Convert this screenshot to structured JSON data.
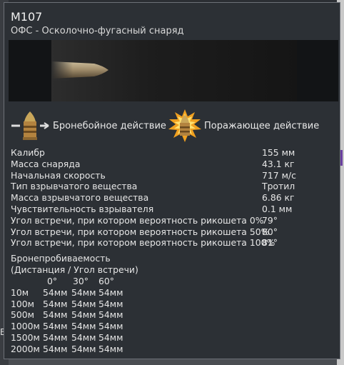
{
  "tooltip": {
    "title": "M107",
    "subtitle": "ОФС - Осколочно-фугасный снаряд"
  },
  "features": {
    "armor_label": "Бронебойное действие",
    "damage_label": "Поражающее действие"
  },
  "stats": [
    {
      "name": "Калибр",
      "value": "155 мм"
    },
    {
      "name": "Масса снаряда",
      "value": "43.1 кг"
    },
    {
      "name": "Начальная скорость",
      "value": "717 м/с"
    },
    {
      "name": "Тип взрывчатого вещества",
      "value": "Тротил"
    },
    {
      "name": "Масса взрывчатого вещества",
      "value": "6.86 кг"
    },
    {
      "name": "Чувствительность взрывателя",
      "value": "0.1 мм"
    },
    {
      "name": "Угол встречи, при котором вероятность рикошета 0%",
      "value": "79°"
    },
    {
      "name": "Угол встречи, при котором вероятность рикошета 50%",
      "value": "80°"
    },
    {
      "name": "Угол встречи, при котором вероятность рикошета 100%",
      "value": "81°"
    }
  ],
  "penetration": {
    "title": "Бронепробиваемость",
    "subtitle": "(Дистанция / Угол встречи)",
    "angles": [
      "0°",
      "30°",
      "60°"
    ],
    "rows": [
      {
        "distance": "10м",
        "values": [
          "54мм",
          "54мм",
          "54мм"
        ]
      },
      {
        "distance": "100м",
        "values": [
          "54мм",
          "54мм",
          "54мм"
        ]
      },
      {
        "distance": "500м",
        "values": [
          "54мм",
          "54мм",
          "54мм"
        ]
      },
      {
        "distance": "1000м",
        "values": [
          "54мм",
          "54мм",
          "54мм"
        ]
      },
      {
        "distance": "1500м",
        "values": [
          "54мм",
          "54мм",
          "54мм"
        ]
      },
      {
        "distance": "2000м",
        "values": [
          "54мм",
          "54мм",
          "54мм"
        ]
      }
    ]
  },
  "icons": {
    "armor": "armor-piercing-shell-icon",
    "damage": "explosive-shell-icon"
  },
  "colors": {
    "panel": "#2c3035",
    "border": "#6d7178",
    "text": "#e6e6e6"
  },
  "background": {
    "left_text": "ВО"
  }
}
